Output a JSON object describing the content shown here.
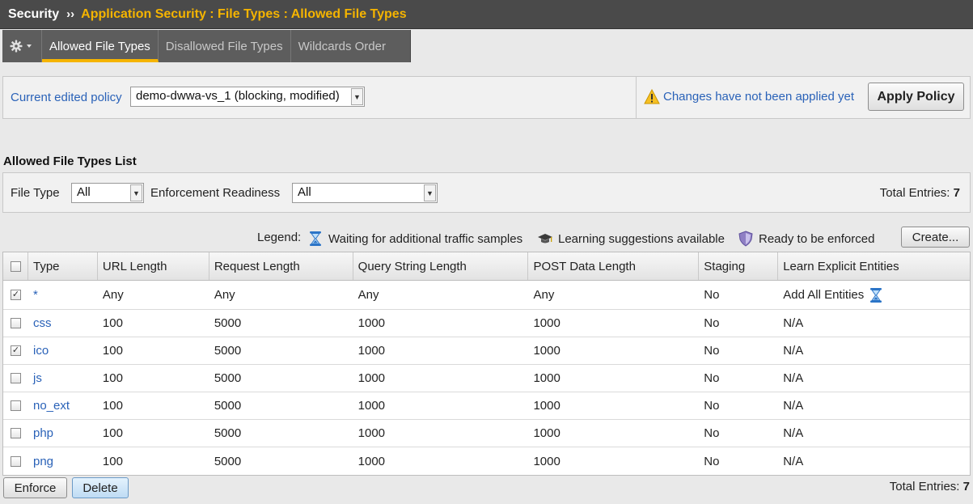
{
  "breadcrumb": {
    "section": "Security",
    "separator": "››",
    "path": "Application Security : File Types : Allowed File Types"
  },
  "tabs": [
    {
      "label": "Allowed File Types",
      "active": true
    },
    {
      "label": "Disallowed File Types",
      "active": false
    },
    {
      "label": "Wildcards Order",
      "active": false
    }
  ],
  "policy": {
    "label": "Current edited policy",
    "selected": "demo-dwwa-vs_1 (blocking, modified)",
    "warning": "Changes have not been applied yet",
    "apply_label": "Apply Policy"
  },
  "list": {
    "title": "Allowed File Types List",
    "filter_file_type_label": "File Type",
    "filter_file_type_value": "All",
    "filter_enforcement_label": "Enforcement Readiness",
    "filter_enforcement_value": "All",
    "total_label": "Total Entries:",
    "total_value": "7"
  },
  "legend": {
    "label": "Legend:",
    "waiting": "Waiting for additional traffic samples",
    "learning": "Learning suggestions available",
    "ready": "Ready to be enforced",
    "create_label": "Create..."
  },
  "table": {
    "headers": [
      "Type",
      "URL Length",
      "Request Length",
      "Query String Length",
      "POST Data Length",
      "Staging",
      "Learn Explicit Entities"
    ],
    "rows": [
      {
        "checked": true,
        "type": "*",
        "url": "Any",
        "request": "Any",
        "query": "Any",
        "post": "Any",
        "staging": "No",
        "learn": "Add All Entities"
      },
      {
        "checked": false,
        "type": "css",
        "url": "100",
        "request": "5000",
        "query": "1000",
        "post": "1000",
        "staging": "No",
        "learn": "N/A"
      },
      {
        "checked": true,
        "type": "ico",
        "url": "100",
        "request": "5000",
        "query": "1000",
        "post": "1000",
        "staging": "No",
        "learn": "N/A"
      },
      {
        "checked": false,
        "type": "js",
        "url": "100",
        "request": "5000",
        "query": "1000",
        "post": "1000",
        "staging": "No",
        "learn": "N/A"
      },
      {
        "checked": false,
        "type": "no_ext",
        "url": "100",
        "request": "5000",
        "query": "1000",
        "post": "1000",
        "staging": "No",
        "learn": "N/A"
      },
      {
        "checked": false,
        "type": "php",
        "url": "100",
        "request": "5000",
        "query": "1000",
        "post": "1000",
        "staging": "No",
        "learn": "N/A"
      },
      {
        "checked": false,
        "type": "png",
        "url": "100",
        "request": "5000",
        "query": "1000",
        "post": "1000",
        "staging": "No",
        "learn": "N/A"
      }
    ]
  },
  "bottom": {
    "enforce_label": "Enforce",
    "delete_label": "Delete"
  },
  "icons": {
    "gear": "gear-icon",
    "warning": "warning-icon",
    "hourglass": "hourglass-icon",
    "mortarboard": "mortarboard-icon",
    "shield": "shield-icon"
  },
  "colors": {
    "accent": "#f5b400",
    "link": "#2a62b8",
    "titlebar": "#4a4a4a"
  }
}
